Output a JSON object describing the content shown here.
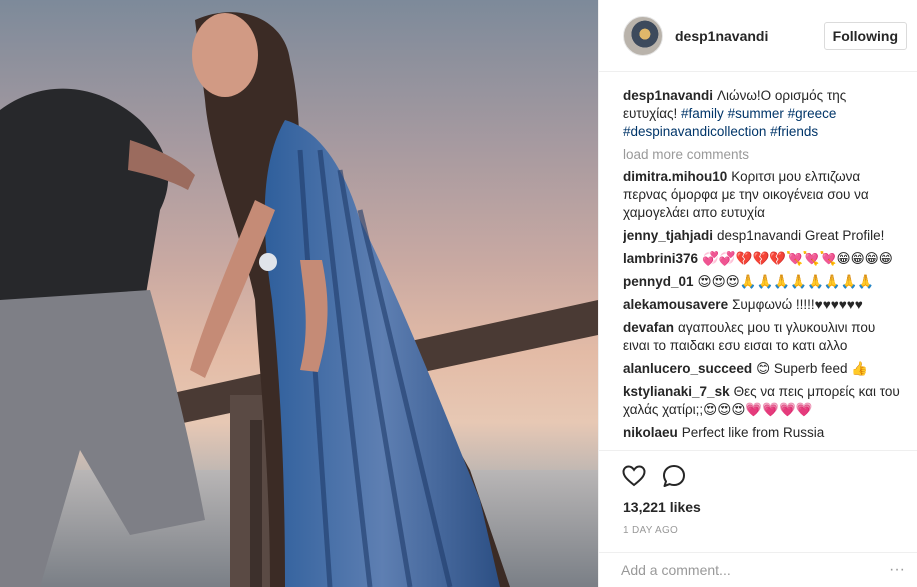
{
  "header": {
    "username": "desp1navandi",
    "follow_label": "Following"
  },
  "caption": {
    "user": "desp1navandi",
    "text": "Λιώνω!Ο ορισμός της ευτυχίας!",
    "hashtags": [
      "#family",
      "#summer",
      "#greece",
      "#despinavandicollection",
      "#friends"
    ]
  },
  "load_more_label": "load more comments",
  "comments": [
    {
      "user": "dimitra.mihou10",
      "text": "Κοριτσι μου ελπιζωνα περνας όμορφα με την οικογένεια σου να χαμογελάει απο ευτυχία"
    },
    {
      "user": "jenny_tjahjadi",
      "text": "desp1navandi Great Profile!"
    },
    {
      "user": "lambrini376",
      "text": "💞💞💔💔💔💘💘💘😁😁😁😁"
    },
    {
      "user": "pennyd_01",
      "text": "😍😍😍🙏🙏🙏🙏🙏🙏🙏🙏"
    },
    {
      "user": "alekamousavere",
      "text": "Συμφωνώ !!!!!♥♥♥♥♥♥"
    },
    {
      "user": "devafan",
      "text": "αγαπουλες μου τι γλυκουλινι που ειναι το παιδακι εσυ εισαι το κατι αλλο"
    },
    {
      "user": "alanlucero_succeed",
      "text": "😊 Superb feed 👍"
    },
    {
      "user": "kstylianaki_7_sk",
      "text": "Θες να πεις μπορείς και του χαλάς χατίρι;;😍😍😍💗💗💗💗"
    },
    {
      "user": "nikolaeu",
      "text": "Perfect like from Russia"
    }
  ],
  "likes": "13,221 likes",
  "timestamp": "1 DAY AGO",
  "add_comment_placeholder": "Add a comment...",
  "more_label": "···",
  "icons": {
    "like": "heart-outline-icon",
    "comment": "speech-bubble-icon",
    "more": "ellipsis-icon"
  },
  "colors": {
    "hashtag": "#003569",
    "muted": "#999999",
    "text": "#262626",
    "border": "#efefef"
  }
}
